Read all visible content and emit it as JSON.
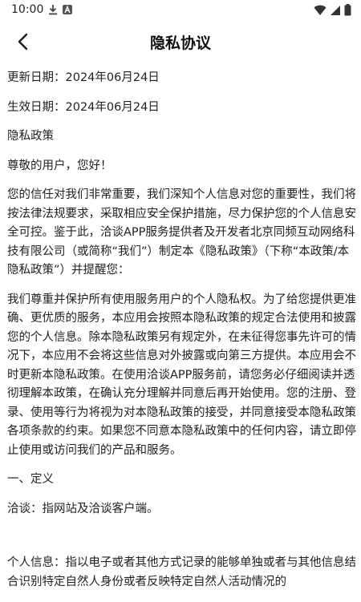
{
  "status_bar": {
    "time": "10:00",
    "icons": [
      "download-icon",
      "a-badge-icon",
      "wifi-icon",
      "signal-icon",
      "battery-icon"
    ]
  },
  "nav": {
    "back_icon": "chevron-left-icon",
    "title": "隐私协议"
  },
  "content": {
    "updated_date": "更新日期：2024年06月24日",
    "effective_date": "生效日期：2024年06月24日",
    "policy_heading": "隐私政策",
    "greeting": "尊敬的用户，您好！",
    "paragraph_1": " 您的信任对我们非常重要，我们深知个人信息对您的重要性，我们将按法律法规要求，采取相应安全保护措施，尽力保护您的个人信息安全可控。鉴于此，洽谈APP服务提供者及开发者北京同频互动网络科技有限公司（或简称“我们”）制定本《隐私政策》（下称“本政策/本隐私政策”）并提醒您：",
    "paragraph_2": " 我们尊重并保护所有使用服务用户的个人隐私权。为了给您提供更准确、更优质的服务，本应用会按照本隐私政策的规定合法使用和披露您的个人信息。除本隐私政策另有规定外，在未征得您事先许可的情况下，本应用不会将这些信息对外披露或向第三方提供。本应用会不时更新本隐私政策。在使用洽谈APP服务前，请您务必仔细阅读并透彻理解本政策，在确认充分理解并同意后再开始使用。您的注册、登录、使用等行为将视为对本隐私政策的接受，并同意接受本隐私政策各项条款的约束。如果您不同意本隐私政策中的任何内容，请立即停止使用或访问我们的产品和服务。",
    "section_1_title": "一、定义",
    "definition_qiatan": "洽谈：指网站及洽谈客户端。",
    "definition_personal_info": "个人信息：指以电子或者其他方式记录的能够单独或者与其他信息结合识别特定自然人身份或者反映特定自然人活动情况的"
  }
}
